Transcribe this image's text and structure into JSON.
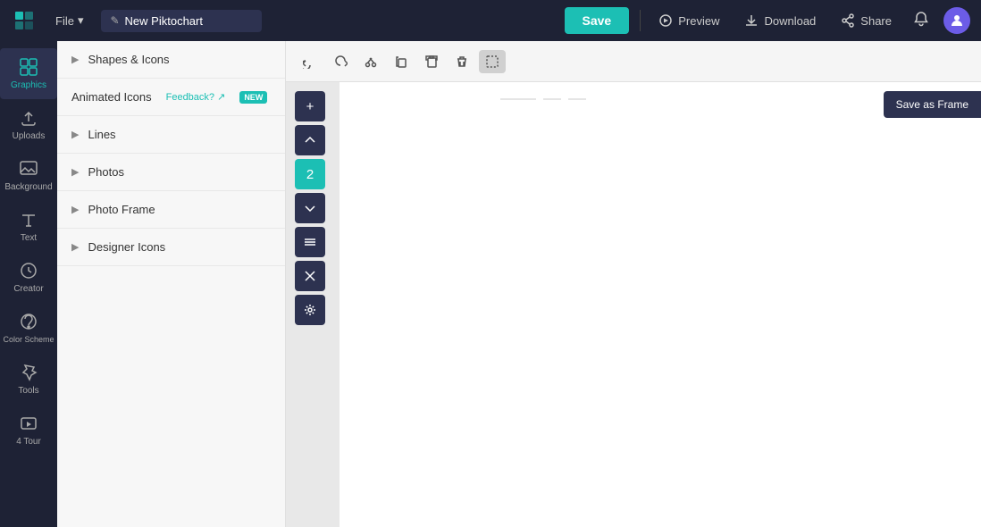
{
  "header": {
    "logo_label": "P",
    "file_label": "File",
    "file_chevron": "▾",
    "title_value": "New Piktochart",
    "pencil_symbol": "✎",
    "save_label": "Save",
    "preview_label": "Preview",
    "download_label": "Download",
    "share_label": "Share",
    "bell_symbol": "🔔",
    "avatar_label": "U"
  },
  "sidebar": {
    "active_item": "graphics",
    "items": [
      {
        "id": "graphics",
        "label": "Graphics",
        "icon": "grid"
      },
      {
        "id": "uploads",
        "label": "Uploads",
        "icon": "upload"
      },
      {
        "id": "background",
        "label": "Background",
        "icon": "image"
      },
      {
        "id": "text",
        "label": "Text",
        "icon": "text"
      },
      {
        "id": "creator",
        "label": "Creator",
        "icon": "wand"
      },
      {
        "id": "color-scheme",
        "label": "Color Scheme",
        "icon": "palette"
      },
      {
        "id": "tools",
        "label": "Tools",
        "icon": "tools"
      },
      {
        "id": "tour",
        "label": "4 Tour",
        "icon": "tour"
      }
    ]
  },
  "panel": {
    "items": [
      {
        "id": "shapes-icons",
        "label": "Shapes & Icons",
        "has_arrow": true,
        "feedback": null,
        "badge": null
      },
      {
        "id": "animated-icons",
        "label": "Animated Icons",
        "has_arrow": false,
        "feedback": "Feedback? ↗",
        "badge": "NEW"
      },
      {
        "id": "lines",
        "label": "Lines",
        "has_arrow": true,
        "feedback": null,
        "badge": null
      },
      {
        "id": "photos",
        "label": "Photos",
        "has_arrow": true,
        "feedback": null,
        "badge": null
      },
      {
        "id": "photo-frame",
        "label": "Photo Frame",
        "has_arrow": true,
        "feedback": null,
        "badge": null
      },
      {
        "id": "designer-icons",
        "label": "Designer Icons",
        "has_arrow": true,
        "feedback": null,
        "badge": null
      }
    ]
  },
  "toolbar": {
    "buttons": [
      {
        "id": "undo",
        "symbol": "↩",
        "label": "Undo",
        "disabled": false
      },
      {
        "id": "redo",
        "symbol": "↪",
        "label": "Redo",
        "disabled": false
      },
      {
        "id": "cut",
        "symbol": "✂",
        "label": "Cut",
        "disabled": false
      },
      {
        "id": "copy",
        "symbol": "⎘",
        "label": "Copy",
        "disabled": false
      },
      {
        "id": "paste",
        "symbol": "📋",
        "label": "Paste",
        "disabled": false
      },
      {
        "id": "delete",
        "symbol": "🗑",
        "label": "Delete",
        "disabled": false
      },
      {
        "id": "select",
        "symbol": "⊡",
        "label": "Select",
        "disabled": false,
        "active": true
      }
    ]
  },
  "canvas_tools": [
    {
      "id": "add",
      "symbol": "+",
      "teal": false
    },
    {
      "id": "expand-up",
      "symbol": "↑",
      "teal": false
    },
    {
      "id": "number",
      "symbol": "2",
      "teal": true
    },
    {
      "id": "expand-down",
      "symbol": "↓",
      "teal": false
    },
    {
      "id": "align",
      "symbol": "☰",
      "teal": false
    },
    {
      "id": "close",
      "symbol": "✕",
      "teal": false
    },
    {
      "id": "settings",
      "symbol": "⚙",
      "teal": false
    }
  ],
  "save_as_frame_label": "Save as Frame",
  "colors": {
    "accent": "#1cbfb4",
    "sidebar_bg": "#1e2235",
    "panel_bg": "#f7f7f7",
    "canvas_tool_bg": "#2d3250"
  }
}
